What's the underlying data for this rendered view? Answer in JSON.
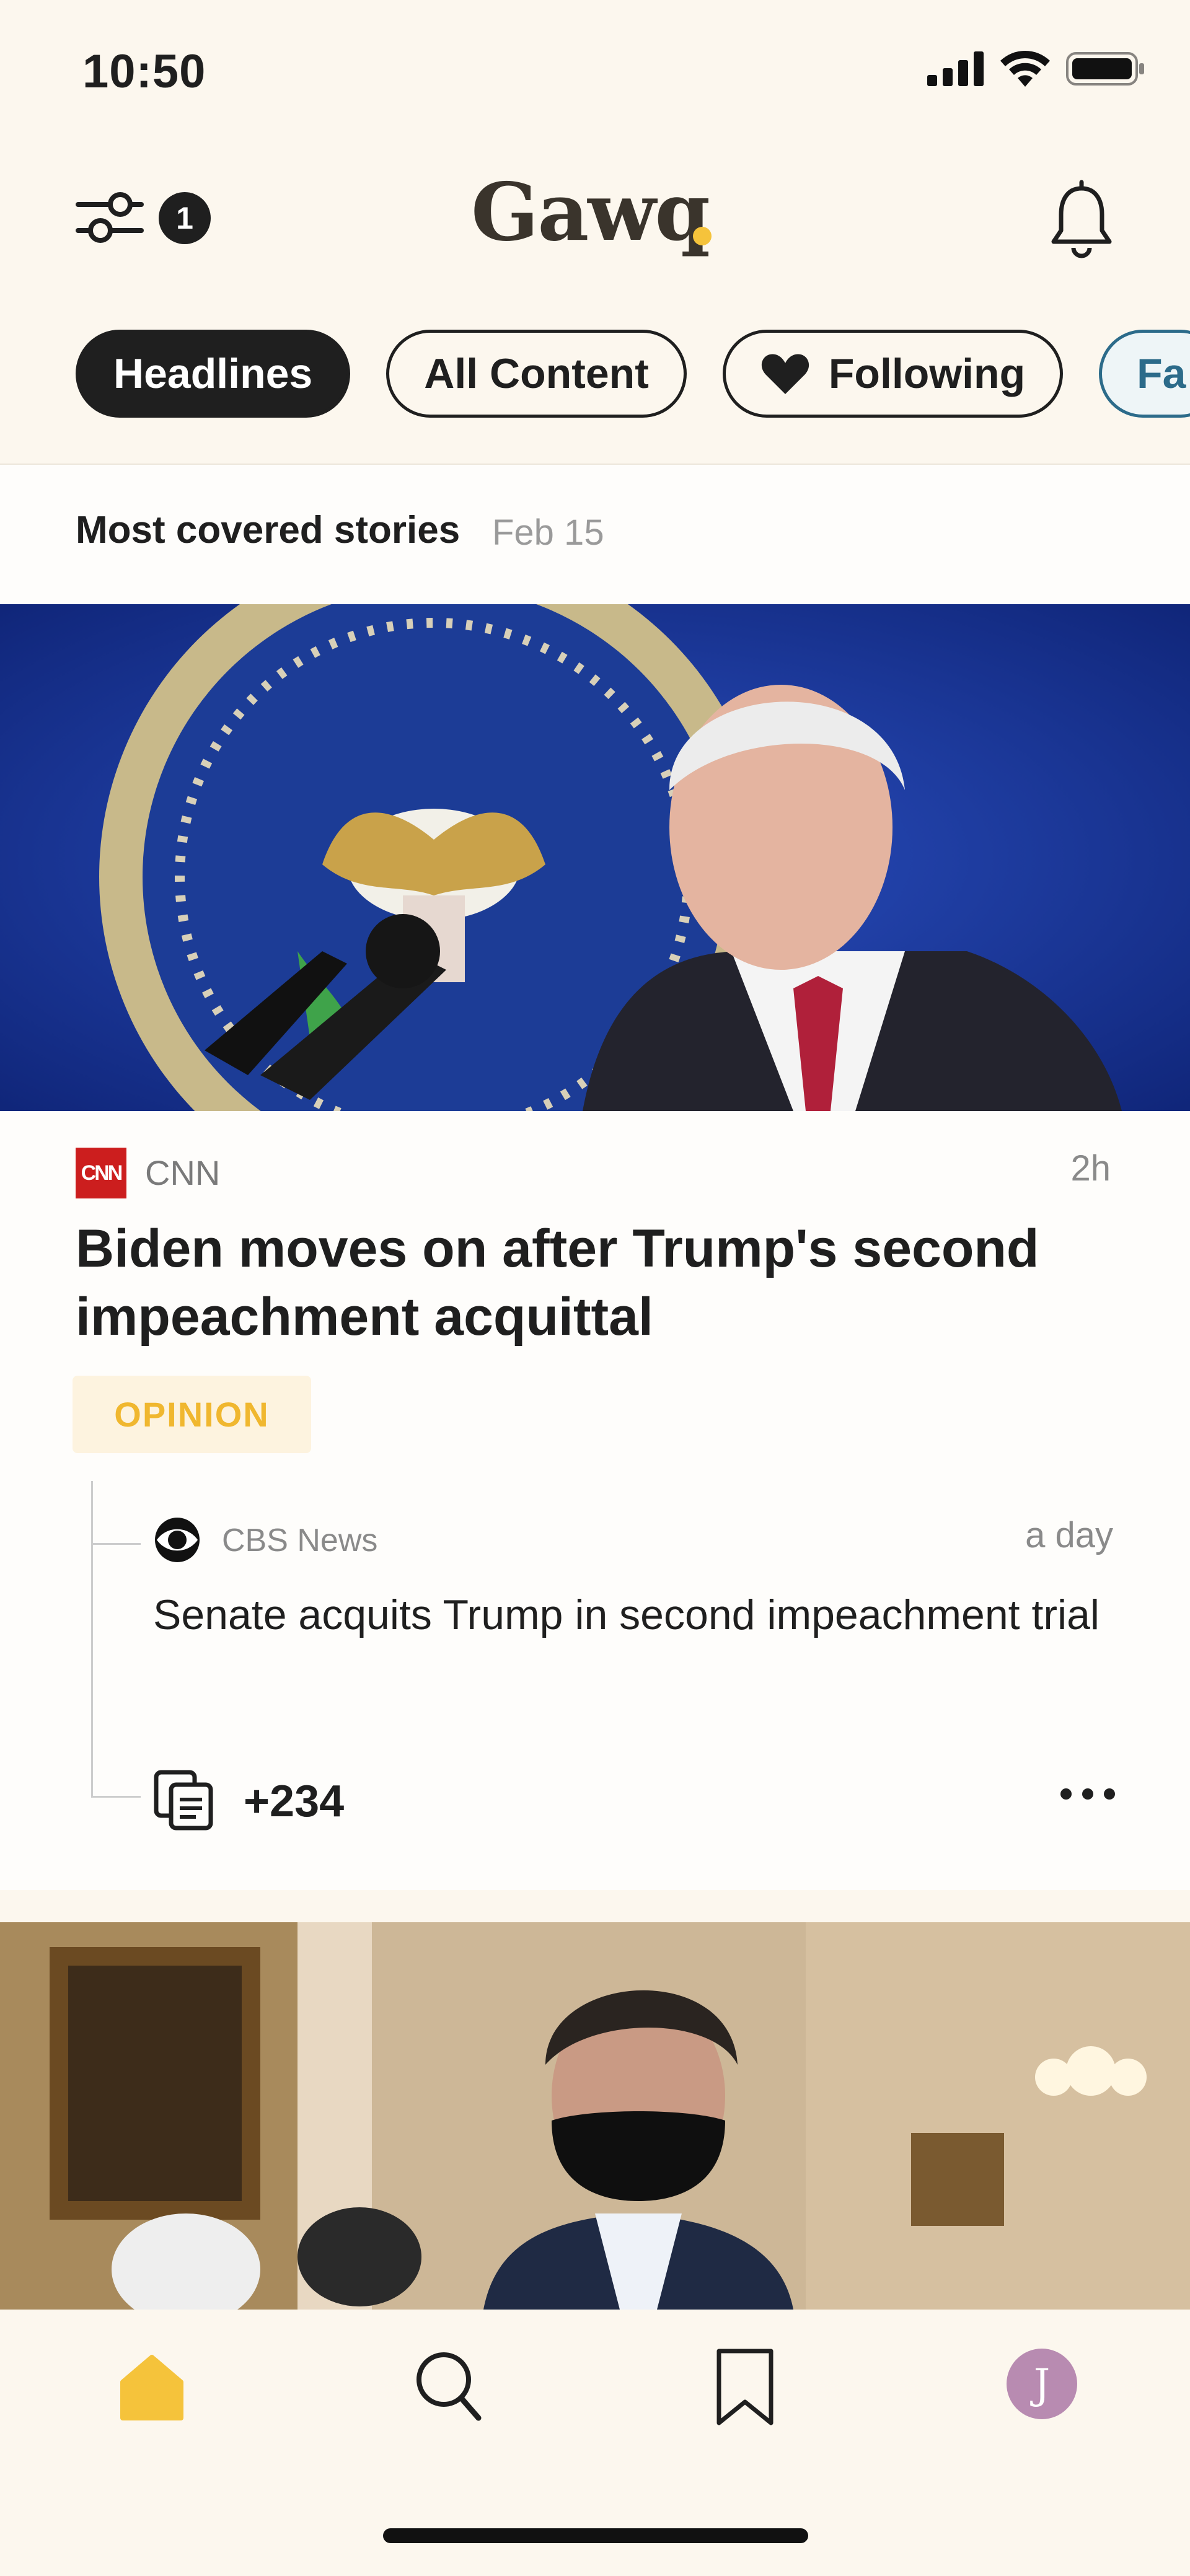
{
  "status_bar": {
    "time": "10:50"
  },
  "header": {
    "filter_badge": "1",
    "logo": "Gawq",
    "icons": {
      "filter": "sliders-icon",
      "notifications": "bell-icon"
    },
    "brand_dot_color": "#f5c33b"
  },
  "tabs": [
    {
      "label": "Headlines",
      "active": true
    },
    {
      "label": "All Content",
      "active": false
    },
    {
      "label": "Following",
      "active": false,
      "icon": "heart-icon"
    },
    {
      "label": "Fa",
      "active": false
    }
  ],
  "section": {
    "title": "Most covered stories",
    "date": "Feb 15"
  },
  "story": {
    "source": "CNN",
    "source_logo": "CNN",
    "time": "2h",
    "headline": "Biden moves on after Trump's second impeachment acquittal",
    "tag": "OPINION",
    "related": {
      "source": "CBS News",
      "time": "a day",
      "headline": "Senate acquits Trump in second impeachment trial"
    },
    "more_count": "+234"
  },
  "bottom_nav": {
    "items": [
      "home-icon",
      "search-icon",
      "bookmark-icon",
      "avatar"
    ],
    "avatar_initial": "J",
    "accent": "#f5c33b"
  }
}
